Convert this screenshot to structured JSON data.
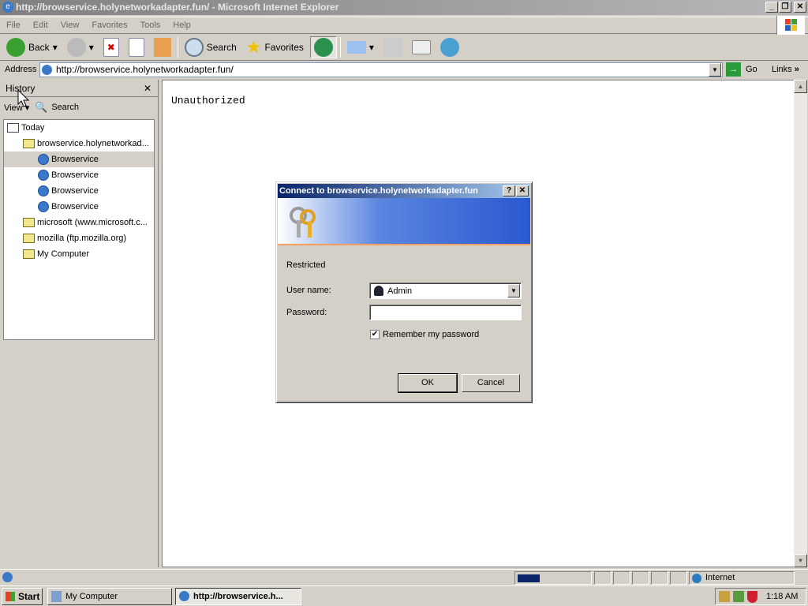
{
  "window": {
    "title": "http://browservice.holynetworkadapter.fun/ - Microsoft Internet Explorer",
    "minimize": "_",
    "restore": "❐",
    "close": "✕"
  },
  "menu": [
    "File",
    "Edit",
    "View",
    "Favorites",
    "Tools",
    "Help"
  ],
  "toolbar": {
    "back": "Back",
    "search": "Search",
    "favorites": "Favorites"
  },
  "address": {
    "label": "Address",
    "value": "http://browservice.holynetworkadapter.fun/",
    "go": "Go",
    "links": "Links",
    "more": "»"
  },
  "history": {
    "title": "History",
    "close": "✕",
    "view": "View",
    "search": "Search",
    "items": [
      {
        "label": "Today",
        "icon": "calendar-icon"
      },
      {
        "label": "browservice.holynetworkad...",
        "icon": "folder-icon"
      },
      {
        "label": "Browservice",
        "icon": "ie-page-icon",
        "selected": true
      },
      {
        "label": "Browservice",
        "icon": "ie-page-icon"
      },
      {
        "label": "Browservice",
        "icon": "ie-page-icon"
      },
      {
        "label": "Browservice",
        "icon": "ie-page-icon"
      },
      {
        "label": "microsoft (www.microsoft.c...",
        "icon": "folder-icon"
      },
      {
        "label": "mozilla (ftp.mozilla.org)",
        "icon": "folder-icon"
      },
      {
        "label": "My Computer",
        "icon": "folder-icon"
      }
    ]
  },
  "page": {
    "text": "Unauthorized"
  },
  "dialog": {
    "title": "Connect to browservice.holynetworkadapter.fun",
    "help": "?",
    "close": "✕",
    "realm": "Restricted",
    "username_label": "User name:",
    "username_value": "Admin",
    "password_label": "Password:",
    "password_value": "",
    "remember_label": "Remember my password",
    "remember_checked": true,
    "ok": "OK",
    "cancel": "Cancel"
  },
  "status": {
    "zone": "Internet"
  },
  "taskbar": {
    "start": "Start",
    "tasks": [
      "My Computer",
      "http://browservice.h..."
    ],
    "clock": "1:18 AM"
  }
}
